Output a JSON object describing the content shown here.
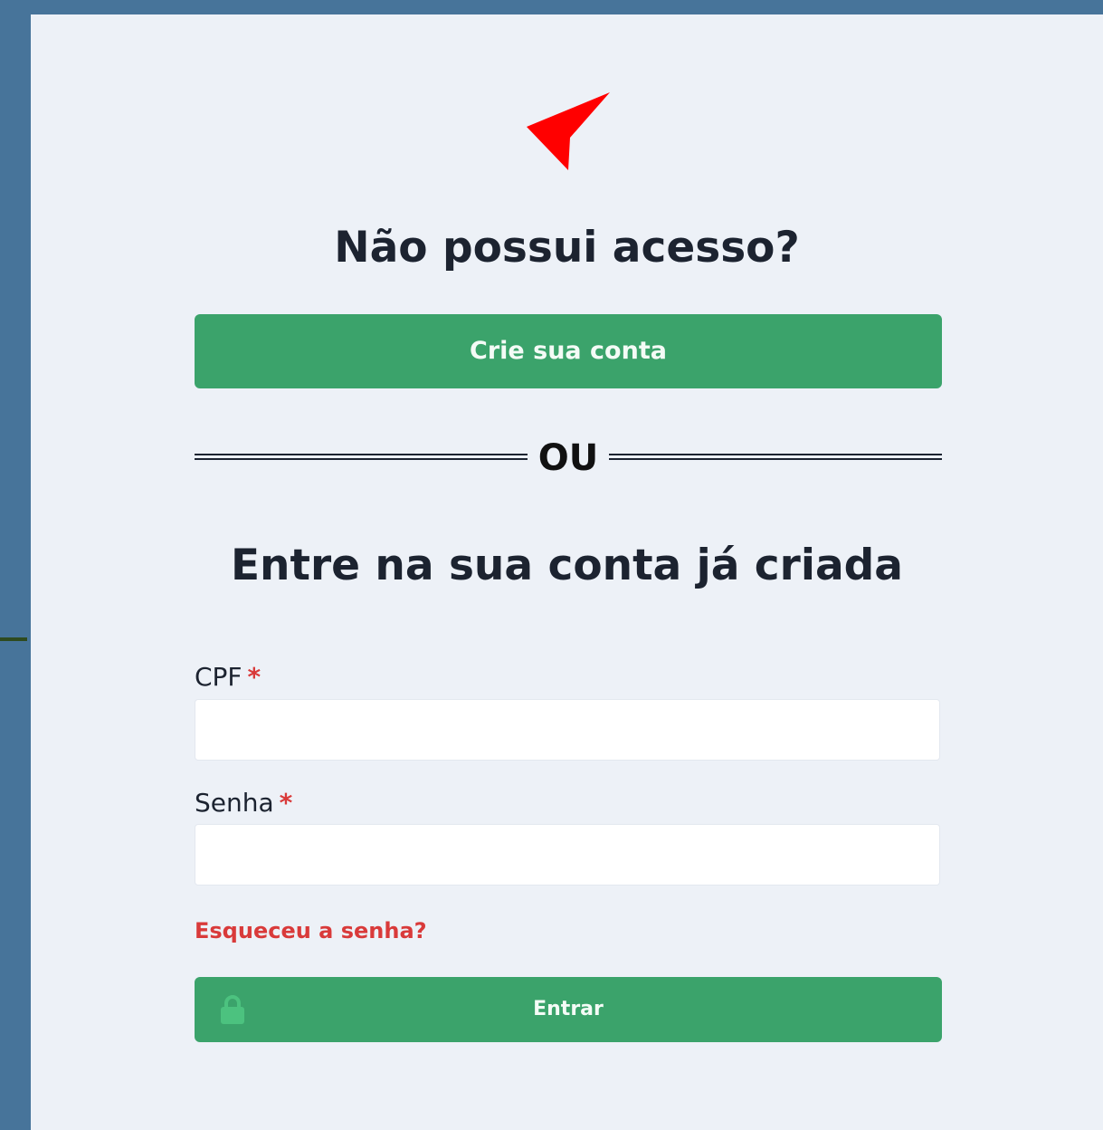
{
  "colors": {
    "outer_background": "#47749a",
    "panel_background": "#edf1f7",
    "primary_button": "#3ba36b",
    "required_mark": "#d93a3a",
    "forgot_link": "#d93a3a",
    "logo": "#ff0000"
  },
  "logo": {
    "icon": "red-arrow-logo-icon"
  },
  "create_section": {
    "heading": "Não possui acesso?",
    "button_label": "Crie sua conta"
  },
  "divider": {
    "text": "OU"
  },
  "login_section": {
    "heading": "Entre na sua conta já criada",
    "cpf": {
      "label": "CPF",
      "required_mark": "*",
      "value": "",
      "placeholder": ""
    },
    "senha": {
      "label": "Senha",
      "required_mark": "*",
      "value": "",
      "placeholder": ""
    },
    "forgot_link": "Esqueceu a senha?",
    "submit_label": "Entrar",
    "submit_icon": "lock-icon"
  }
}
